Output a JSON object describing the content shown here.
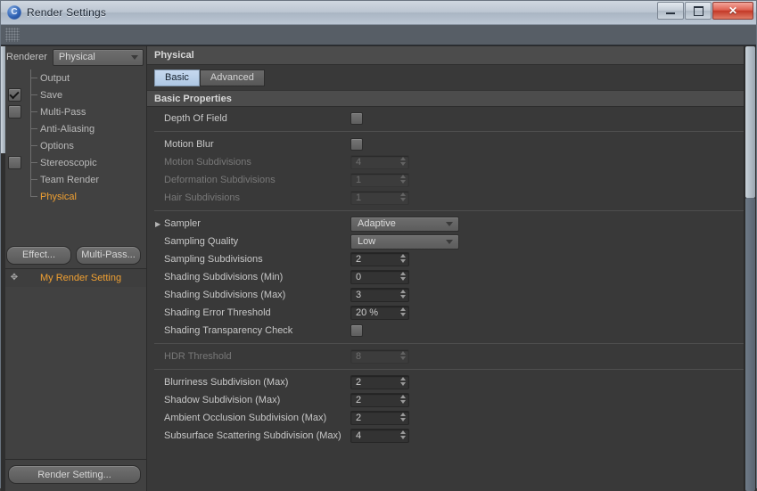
{
  "window": {
    "title": "Render Settings",
    "icon": "c4d-logo-icon",
    "controls": {
      "minimize": "minimize-icon",
      "maximize": "maximize-icon",
      "close": "✕"
    }
  },
  "toolbar": {
    "grip": "drag-grip-icon"
  },
  "sidebar": {
    "renderer_label": "Renderer",
    "renderer_value": "Physical",
    "tree": [
      {
        "label": "Output",
        "checkbox": "none",
        "selected": false
      },
      {
        "label": "Save",
        "checkbox": "checked",
        "selected": false
      },
      {
        "label": "Multi-Pass",
        "checkbox": "unchecked",
        "selected": false
      },
      {
        "label": "Anti-Aliasing",
        "checkbox": "none",
        "selected": false
      },
      {
        "label": "Options",
        "checkbox": "none",
        "selected": false
      },
      {
        "label": "Stereoscopic",
        "checkbox": "unchecked",
        "selected": false
      },
      {
        "label": "Team Render",
        "checkbox": "none",
        "selected": false
      },
      {
        "label": "Physical",
        "checkbox": "none",
        "selected": true
      }
    ],
    "buttons": {
      "effect": "Effect...",
      "multipass": "Multi-Pass..."
    },
    "render_setting_item": "My Render Setting",
    "render_setting_button": "Render Setting..."
  },
  "panel": {
    "title": "Physical",
    "tabs": [
      {
        "label": "Basic",
        "active": true
      },
      {
        "label": "Advanced",
        "active": false
      }
    ],
    "section_title": "Basic Properties",
    "rows": [
      {
        "label": "Depth Of Field",
        "type": "checkbox",
        "value": "",
        "disabled": false,
        "expander": false
      },
      {
        "label": "Motion Blur",
        "type": "checkbox",
        "value": "",
        "disabled": false,
        "expander": false,
        "sep_before": true
      },
      {
        "label": "Motion Subdivisions",
        "type": "spinner",
        "value": "4",
        "disabled": true,
        "expander": false
      },
      {
        "label": "Deformation Subdivisions",
        "type": "spinner",
        "value": "1",
        "disabled": true,
        "expander": false
      },
      {
        "label": "Hair Subdivisions",
        "type": "spinner",
        "value": "1",
        "disabled": true,
        "expander": false
      },
      {
        "label": "Sampler",
        "type": "dropdown",
        "value": "Adaptive",
        "disabled": false,
        "expander": true,
        "sep_before": true
      },
      {
        "label": "Sampling Quality",
        "type": "dropdown",
        "value": "Low",
        "disabled": false,
        "expander": false
      },
      {
        "label": "Sampling Subdivisions",
        "type": "spinner",
        "value": "2",
        "disabled": false,
        "expander": false
      },
      {
        "label": "Shading Subdivisions (Min)",
        "type": "spinner",
        "value": "0",
        "disabled": false,
        "expander": false
      },
      {
        "label": "Shading Subdivisions (Max)",
        "type": "spinner",
        "value": "3",
        "disabled": false,
        "expander": false
      },
      {
        "label": "Shading Error Threshold",
        "type": "spinner",
        "value": "20 %",
        "disabled": false,
        "expander": false
      },
      {
        "label": "Shading Transparency Check",
        "type": "checkbox",
        "value": "",
        "disabled": false,
        "expander": false
      },
      {
        "label": "HDR Threshold",
        "type": "spinner",
        "value": "8",
        "disabled": true,
        "expander": false,
        "sep_before": true
      },
      {
        "label": "Blurriness Subdivision (Max)",
        "type": "spinner",
        "value": "2",
        "disabled": false,
        "expander": false,
        "sep_before": true
      },
      {
        "label": "Shadow Subdivision (Max)",
        "type": "spinner",
        "value": "2",
        "disabled": false,
        "expander": false
      },
      {
        "label": "Ambient Occlusion Subdivision (Max)",
        "type": "spinner",
        "value": "2",
        "disabled": false,
        "expander": false
      },
      {
        "label": "Subsurface Scattering Subdivision (Max)",
        "type": "spinner",
        "value": "4",
        "disabled": false,
        "expander": false
      }
    ]
  },
  "colors": {
    "accent_orange": "#f0a032",
    "tab_active_bg": "#c6d9ef",
    "panel_bg": "#393939",
    "sidebar_bg": "#414141"
  }
}
